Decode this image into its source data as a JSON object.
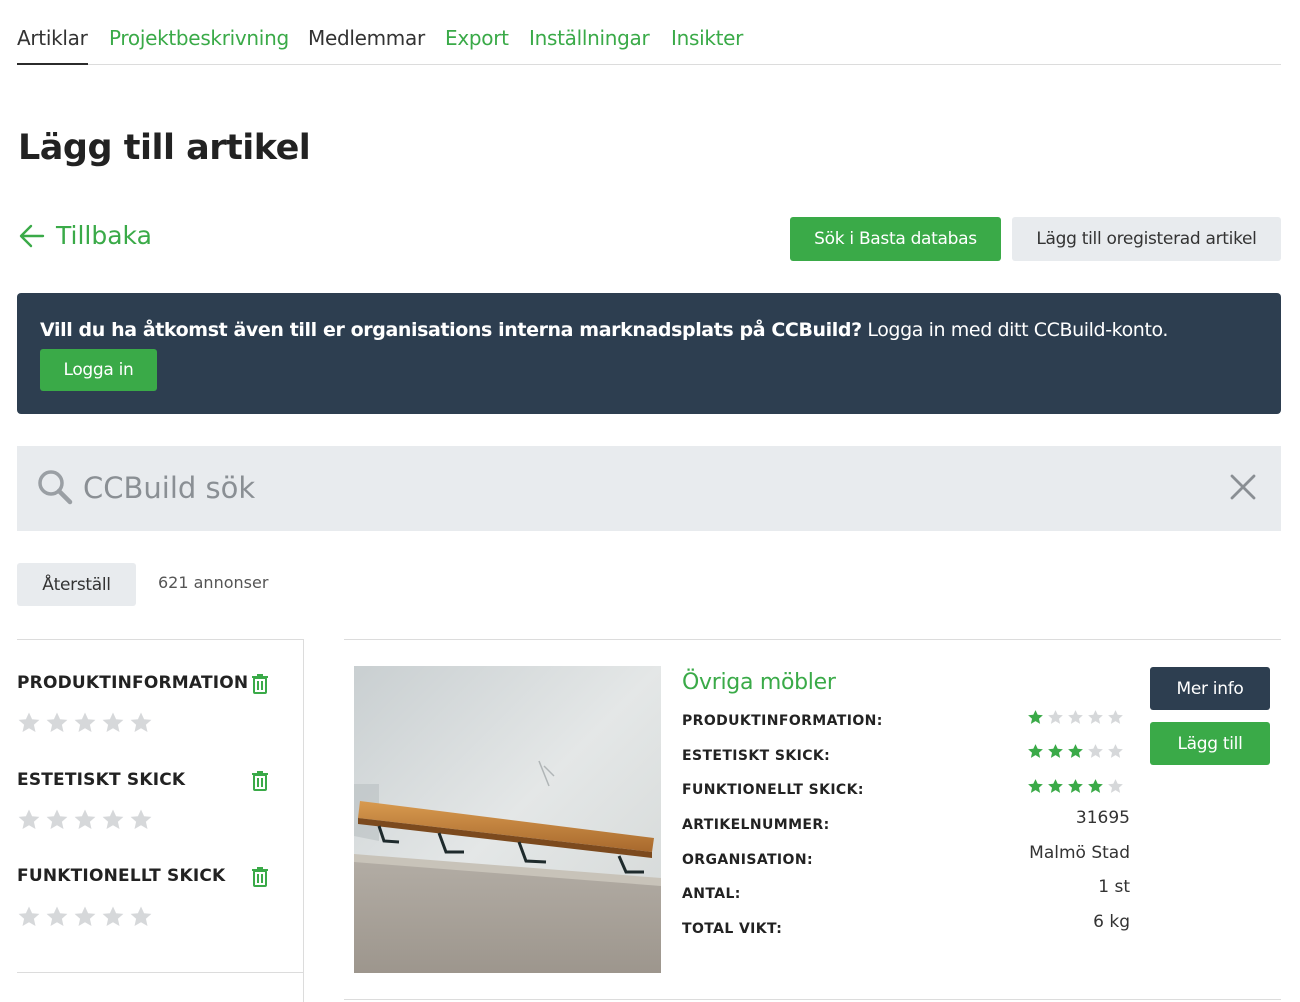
{
  "tabs": [
    {
      "label": "Artiklar",
      "active": true
    },
    {
      "label": "Projektbeskrivning"
    },
    {
      "label": "Medlemmar"
    },
    {
      "label": "Export"
    },
    {
      "label": "Inställningar"
    },
    {
      "label": "Insikter"
    }
  ],
  "page_title": "Lägg till artikel",
  "back_label": "Tillbaka",
  "actions": {
    "search_basta": "Sök i Basta databas",
    "add_unregistered": "Lägg till oregisterad artikel"
  },
  "banner": {
    "bold_text": "Vill du ha åtkomst även till er organisations interna marknadsplats på CCBuild?",
    "text": " Logga in med ditt CCBuild-konto.",
    "login_label": "Logga in"
  },
  "search": {
    "placeholder": "CCBuild sök",
    "value": ""
  },
  "reset_label": "Återställ",
  "result_count": "621 annonser",
  "filters": [
    {
      "label": "PRODUKTINFORMATION",
      "stars": 0
    },
    {
      "label": "ESTETISKT SKICK",
      "stars": 0
    },
    {
      "label": "FUNKTIONELLT SKICK",
      "stars": 0
    }
  ],
  "card": {
    "title": "Övriga möbler",
    "more_info": "Mer info",
    "add": "Lägg till",
    "ratings": [
      {
        "label": "PRODUKTINFORMATION:",
        "stars": 1
      },
      {
        "label": "ESTETISKT SKICK:",
        "stars": 3
      },
      {
        "label": "FUNKTIONELLT SKICK:",
        "stars": 4
      }
    ],
    "props": [
      {
        "label": "ARTIKELNUMMER:",
        "value": "31695"
      },
      {
        "label": "ORGANISATION:",
        "value": "Malmö Stad"
      },
      {
        "label": "ANTAL:",
        "value": "1 st"
      },
      {
        "label": "TOTAL VIKT:",
        "value": "6 kg"
      }
    ]
  },
  "colors": {
    "accent": "#3aaa48",
    "dark": "#2d3e50",
    "grey_bg": "#e8ebee",
    "star_off": "#d6d8da"
  }
}
